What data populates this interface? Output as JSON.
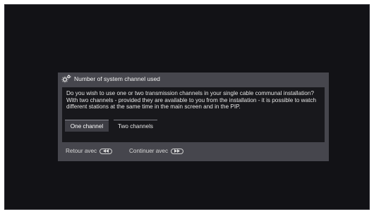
{
  "dialog": {
    "title": "Number of system channel used",
    "header_icon": "gears-icon",
    "message": "Do you wish to use one or two transmission channels in your single cable communal installation? With two channels - provided they are available to you from the installation - it is possible to watch different stations at the same time in the main screen and in the PIP.",
    "options": [
      {
        "label": "One channel",
        "selected": true
      },
      {
        "label": "Two channels",
        "selected": false
      }
    ]
  },
  "footer": {
    "back_label": "Retour avec",
    "back_icon": "rewind-button-icon",
    "continue_label": "Continuer avec",
    "continue_icon": "fast-forward-button-icon"
  },
  "colors": {
    "screen_bg": "#121216",
    "dialog_bg": "#46464d",
    "body_bg": "#18181c",
    "selected_bg": "#3d3d44"
  }
}
